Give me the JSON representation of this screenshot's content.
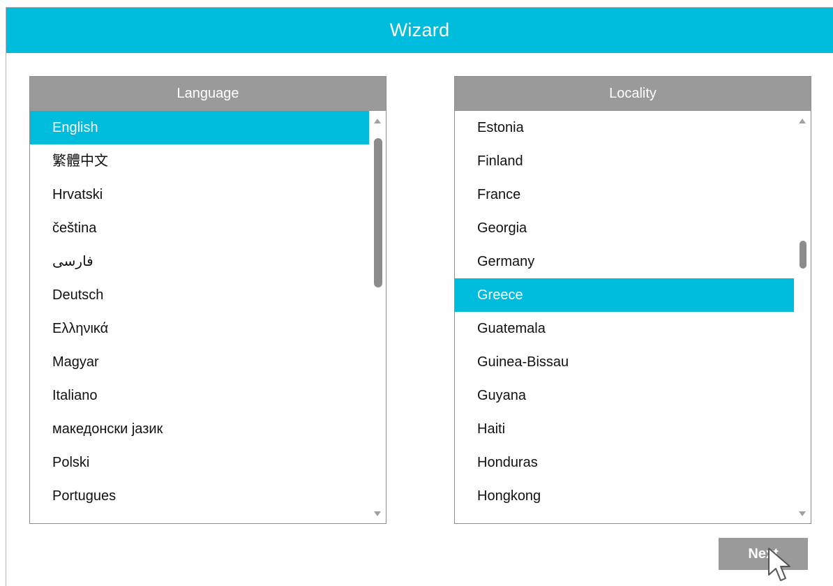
{
  "window": {
    "title": "Wizard"
  },
  "language_panel": {
    "header": "Language",
    "items": [
      {
        "label": "English",
        "selected": true
      },
      {
        "label": "繁體中文",
        "selected": false
      },
      {
        "label": "Hrvatski",
        "selected": false
      },
      {
        "label": "čeština",
        "selected": false
      },
      {
        "label": "فارسی",
        "selected": false
      },
      {
        "label": "Deutsch",
        "selected": false
      },
      {
        "label": "Ελληνικά",
        "selected": false
      },
      {
        "label": "Magyar",
        "selected": false
      },
      {
        "label": "Italiano",
        "selected": false
      },
      {
        "label": "македонски јазик",
        "selected": false
      },
      {
        "label": "Polski",
        "selected": false
      },
      {
        "label": "Portugues",
        "selected": false
      }
    ]
  },
  "locality_panel": {
    "header": "Locality",
    "items": [
      {
        "label": "Estonia",
        "selected": false
      },
      {
        "label": "Finland",
        "selected": false
      },
      {
        "label": "France",
        "selected": false
      },
      {
        "label": "Georgia",
        "selected": false
      },
      {
        "label": "Germany",
        "selected": false
      },
      {
        "label": "Greece",
        "selected": true
      },
      {
        "label": "Guatemala",
        "selected": false
      },
      {
        "label": "Guinea-Bissau",
        "selected": false
      },
      {
        "label": "Guyana",
        "selected": false
      },
      {
        "label": "Haiti",
        "selected": false
      },
      {
        "label": "Honduras",
        "selected": false
      },
      {
        "label": "Hongkong",
        "selected": false
      }
    ]
  },
  "footer": {
    "next_label": "Next"
  },
  "colors": {
    "accent": "#00bcdc",
    "header_gray": "#9a9a9a"
  }
}
